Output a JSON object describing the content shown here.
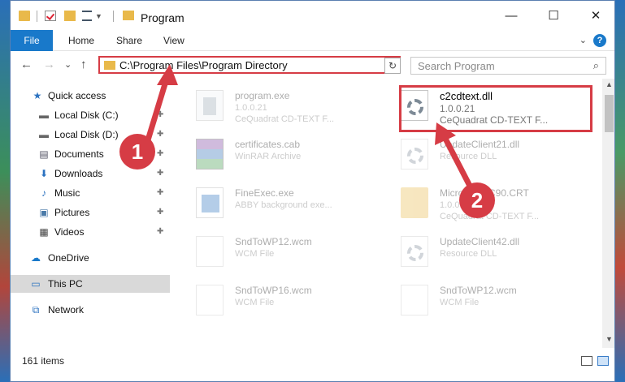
{
  "window": {
    "title": "Program",
    "minimize": "—",
    "maximize": "☐",
    "close": "✕"
  },
  "ribbon": {
    "file": "File",
    "home": "Home",
    "share": "Share",
    "view": "View",
    "help": "?"
  },
  "nav": {
    "back": "←",
    "forward": "→",
    "recent": "⌄",
    "up": "↑",
    "address": "C:\\Program Files\\Program Directory",
    "refresh": "↻",
    "search_placeholder": "Search Program",
    "search_glyph": "⌕"
  },
  "sidebar": {
    "items": [
      {
        "label": "Quick access",
        "icon": "star-icon",
        "glyph": "★"
      },
      {
        "label": "Local Disk (C:)",
        "icon": "drive-icon",
        "glyph": "▬"
      },
      {
        "label": "Local Disk (D:)",
        "icon": "drive-icon",
        "glyph": "▬"
      },
      {
        "label": "Documents",
        "icon": "documents-icon",
        "glyph": "▤"
      },
      {
        "label": "Downloads",
        "icon": "download-icon",
        "glyph": "⬇"
      },
      {
        "label": "Music",
        "icon": "music-icon",
        "glyph": "♪"
      },
      {
        "label": "Pictures",
        "icon": "pictures-icon",
        "glyph": "▣"
      },
      {
        "label": "Videos",
        "icon": "videos-icon",
        "glyph": "▦"
      },
      {
        "label": "OneDrive",
        "icon": "cloud-icon",
        "glyph": "☁"
      },
      {
        "label": "This PC",
        "icon": "computer-icon",
        "glyph": "▭"
      },
      {
        "label": "Network",
        "icon": "network-icon",
        "glyph": "⧉"
      }
    ],
    "pin_glyph": "📌"
  },
  "files": [
    {
      "name": "program.exe",
      "line1": "1.0.0.21",
      "line2": "CeQuadrat CD-TEXT F...",
      "icon": "exe-icon"
    },
    {
      "name": "c2cdtext.dll",
      "line1": "1.0.0.21",
      "line2": "CeQuadrat CD-TEXT F...",
      "icon": "dll-gear-icon"
    },
    {
      "name": "certificates.cab",
      "line1": "WinRAR Archive",
      "line2": "",
      "icon": "rar-icon"
    },
    {
      "name": "UpdateClient21.dll",
      "line1": "Resource DLL",
      "line2": "",
      "icon": "dll-gear-icon"
    },
    {
      "name": "FineExec.exe",
      "line1": "ABBY background exe...",
      "line2": "",
      "icon": "app-icon"
    },
    {
      "name": "Microsoft.VC90.CRT",
      "line1": "1.0.0.21",
      "line2": "CeQuadrat CD-TEXT F...",
      "icon": "folder-icon"
    },
    {
      "name": "SndToWP12.wcm",
      "line1": "WCM File",
      "line2": "",
      "icon": "document-icon"
    },
    {
      "name": "UpdateClient42.dll",
      "line1": "Resource DLL",
      "line2": "",
      "icon": "dll-gear-icon"
    },
    {
      "name": "SndToWP16.wcm",
      "line1": "WCM File",
      "line2": "",
      "icon": "document-icon"
    },
    {
      "name": "SndToWP12.wcm",
      "line1": "WCM File",
      "line2": "",
      "icon": "document-icon"
    }
  ],
  "status": {
    "items": "161 items"
  },
  "annotations": {
    "step1": "1",
    "step2": "2",
    "color": "#d63c45"
  },
  "colors": {
    "accent": "#1979ca",
    "highlight": "#d63c45",
    "folder": "#e9b94a"
  }
}
